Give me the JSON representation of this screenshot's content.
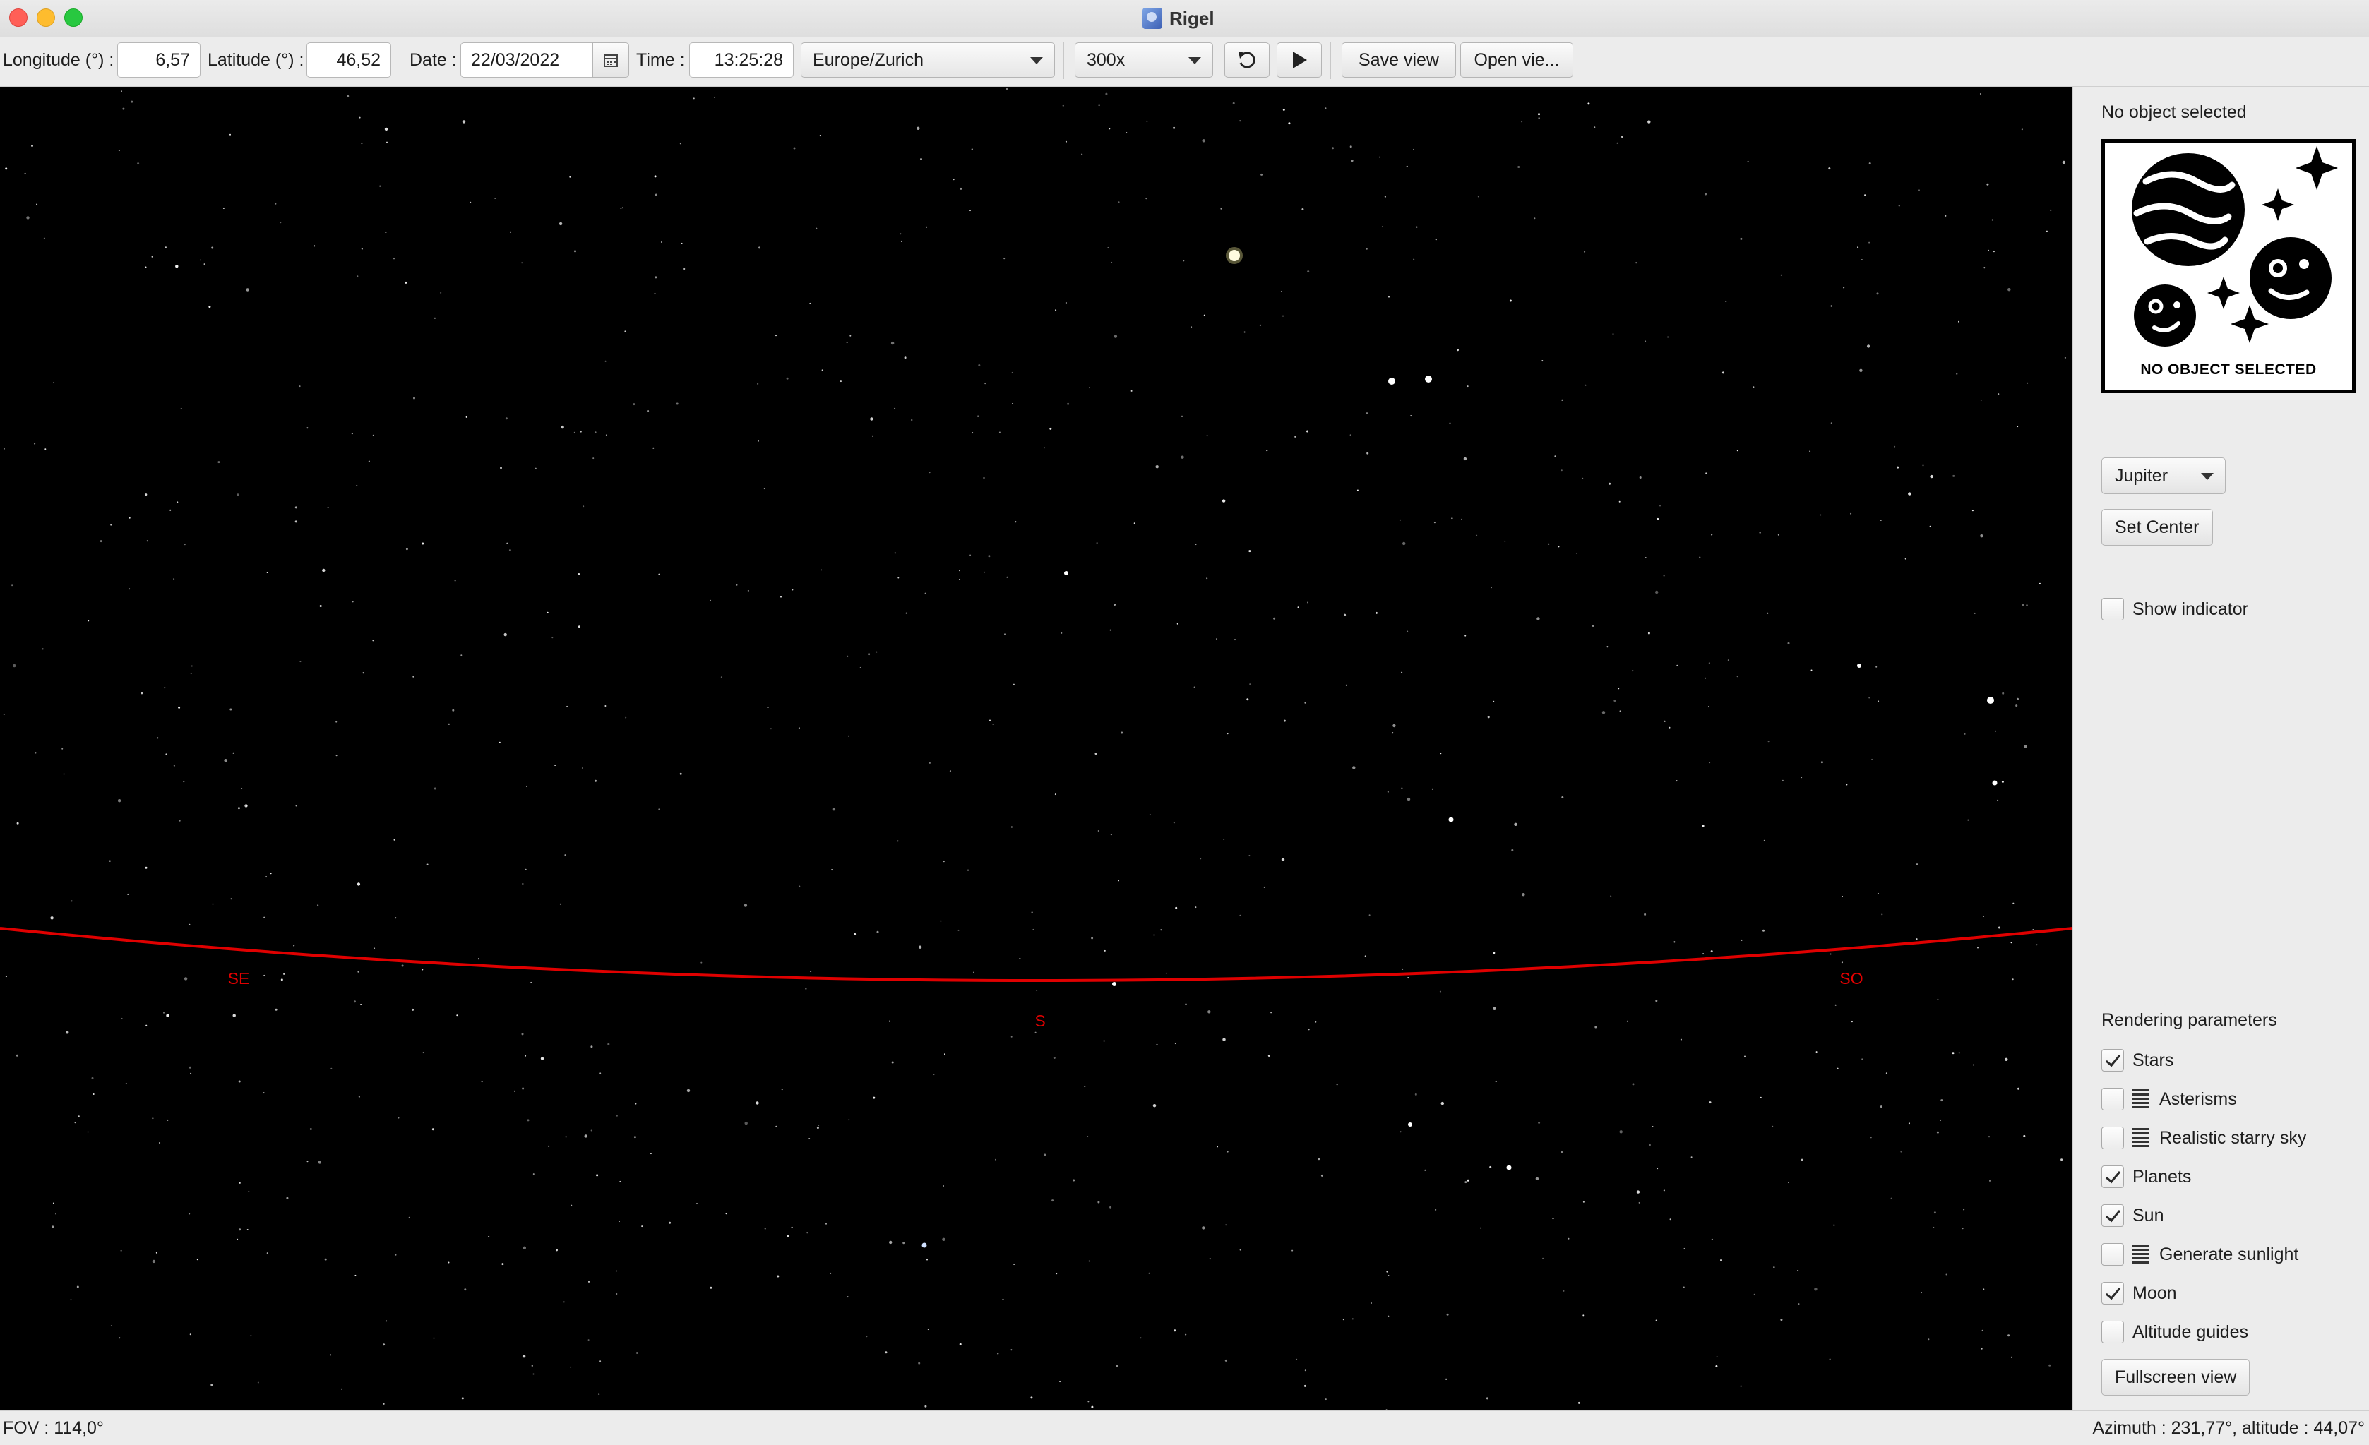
{
  "window": {
    "title": "Rigel"
  },
  "toolbar": {
    "longitude_label": "Longitude (°) :",
    "longitude_value": "6,57",
    "latitude_label": "Latitude (°) :",
    "latitude_value": "46,52",
    "date_label": "Date :",
    "date_value": "22/03/2022",
    "time_label": "Time :",
    "time_value": "13:25:28",
    "timezone": "Europe/Zurich",
    "speed": "300x",
    "save_view": "Save view",
    "open_view": "Open vie..."
  },
  "sky": {
    "horizon_color": "#e00000",
    "cardinals": {
      "se": "SE",
      "s": "S",
      "so": "SO"
    }
  },
  "side_panel": {
    "selection_title": "No object selected",
    "image_caption": "NO OBJECT SELECTED",
    "object_choice": "Jupiter",
    "set_center": "Set Center",
    "show_indicator": {
      "label": "Show indicator",
      "checked": false
    },
    "rendering_title": "Rendering parameters",
    "rendering": [
      {
        "label": "Stars",
        "checked": true,
        "has_options": false
      },
      {
        "label": "Asterisms",
        "checked": false,
        "has_options": true
      },
      {
        "label": "Realistic starry sky",
        "checked": false,
        "has_options": true
      },
      {
        "label": "Planets",
        "checked": true,
        "has_options": false
      },
      {
        "label": "Sun",
        "checked": true,
        "has_options": false
      },
      {
        "label": "Generate sunlight",
        "checked": false,
        "has_options": true
      },
      {
        "label": "Moon",
        "checked": true,
        "has_options": false
      },
      {
        "label": "Altitude guides",
        "checked": false,
        "has_options": false
      }
    ],
    "fullscreen": "Fullscreen view"
  },
  "status": {
    "fov": "FOV : 114,0°",
    "cursor": "Azimuth : 231,77°, altitude : 44,07°"
  }
}
